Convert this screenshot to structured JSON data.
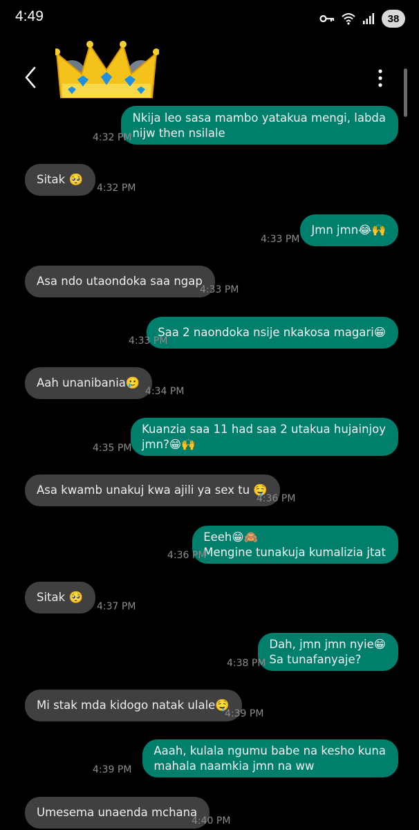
{
  "status_bar": {
    "time": "4:49",
    "battery": "38"
  },
  "header": {
    "avatar_icon": "crown-avatar-icon",
    "back_icon": "chevron-left-icon",
    "menu_icon": "kebab-menu-icon"
  },
  "colors": {
    "outgoing_bubble": "#007f6c",
    "incoming_bubble": "#404040",
    "background": "#000000"
  },
  "messages": [
    {
      "dir": "out",
      "text": "Nkija leo sasa mambo yatakua mengi, labda\nnijw then nsilale",
      "time": "4:32 PM"
    },
    {
      "dir": "in",
      "text": "Sitak 🥺",
      "time": "4:32 PM"
    },
    {
      "dir": "out",
      "text": "Jmn jmn😂🙌",
      "time": "4:33 PM"
    },
    {
      "dir": "in",
      "text": "Asa ndo utaondoka saa ngap",
      "time": "4:33 PM"
    },
    {
      "dir": "out",
      "text": "Saa 2 naondoka nsije nkakosa magari😁",
      "time": "4:33 PM"
    },
    {
      "dir": "in",
      "text": "Aah unanibania🥲",
      "time": "4:34 PM"
    },
    {
      "dir": "out",
      "text": "Kuanzia saa 11 had saa 2 utakua hujainjoy\njmn?😁🙌",
      "time": "4:35 PM"
    },
    {
      "dir": "in",
      "text": "Asa kwamb unakuj kwa ajili ya sex tu 🤤",
      "time": "4:36 PM"
    },
    {
      "dir": "out",
      "text": "Eeeh😁🙈\nMengine tunakuja kumalizia jtat",
      "time": "4:36 PM"
    },
    {
      "dir": "in",
      "text": "Sitak 🥺",
      "time": "4:37 PM"
    },
    {
      "dir": "out",
      "text": "Dah, jmn jmn nyie😁\nSa tunafanyaje?",
      "time": "4:38 PM"
    },
    {
      "dir": "in",
      "text": "Mi stak mda kidogo natak ulale🤤",
      "time": "4:39 PM"
    },
    {
      "dir": "out",
      "text": "Aaah, kulala ngumu babe na kesho kuna\nmahala naamkia jmn na ww",
      "time": "4:39 PM"
    },
    {
      "dir": "in",
      "text": "Umesema unaenda mchana",
      "time": "4:40 PM"
    }
  ]
}
